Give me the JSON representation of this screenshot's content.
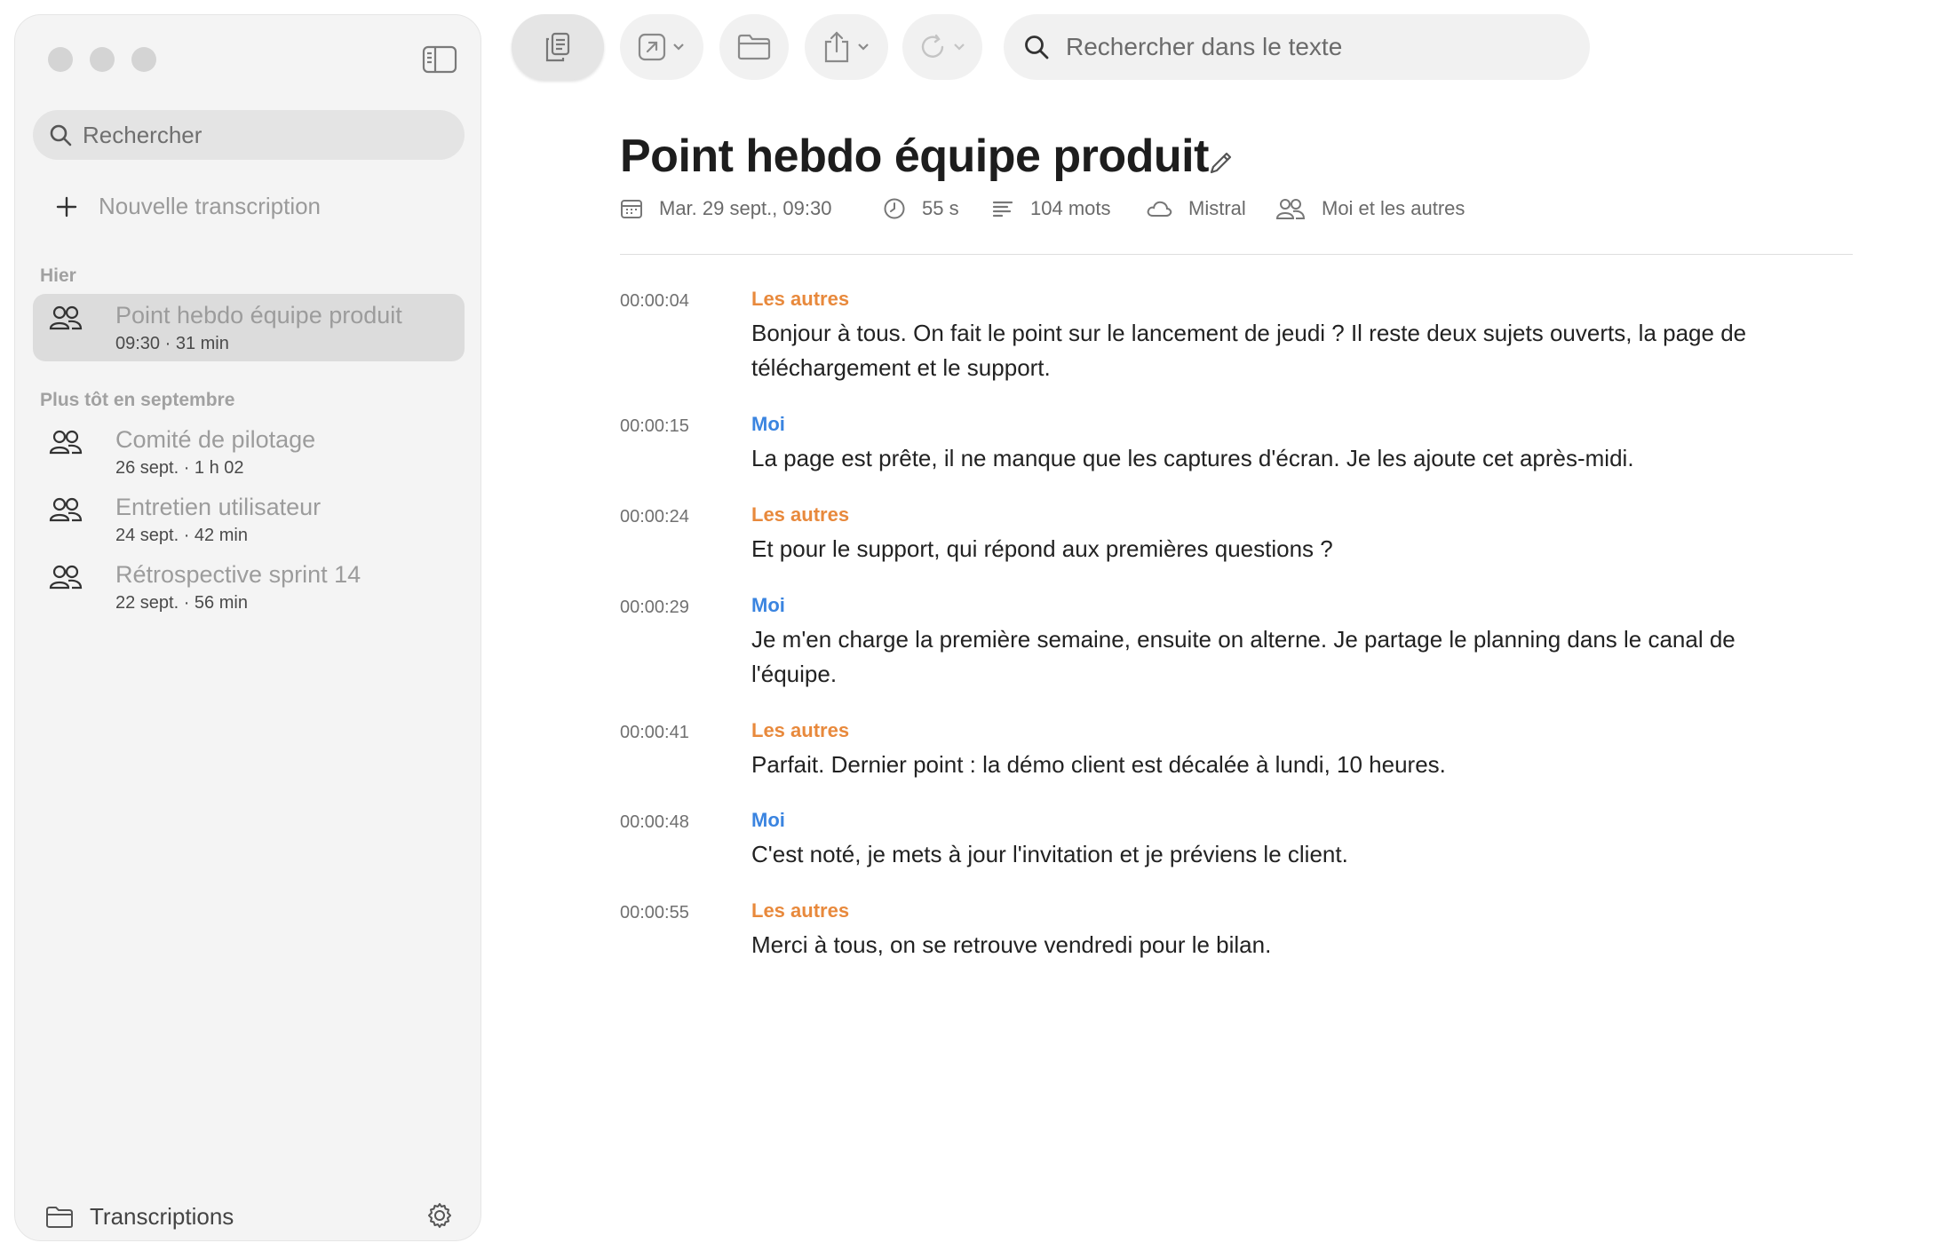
{
  "sidebar": {
    "search_placeholder": "Rechercher",
    "new_transcription": "Nouvelle transcription",
    "sections": [
      {
        "title": "Hier",
        "items": [
          {
            "title": "Point hebdo équipe produit",
            "meta": "09:30 · 31 min",
            "icon": "people-icon",
            "selected": true
          }
        ]
      },
      {
        "title": "Plus tôt en septembre",
        "items": [
          {
            "title": "Comité de pilotage",
            "meta": "26 sept. · 1 h 02",
            "icon": "people-icon"
          },
          {
            "title": "Entretien utilisateur",
            "meta": "24 sept. · 42 min",
            "icon": "people-icon"
          },
          {
            "title": "Rétrospective sprint 14",
            "meta": "22 sept. · 56 min",
            "icon": "people-icon"
          }
        ]
      }
    ],
    "footer_label": "Transcriptions"
  },
  "toolbar": {
    "buttons": [
      "copy-icon",
      "open-external-icon",
      "folder-icon",
      "share-icon",
      "refresh-icon"
    ],
    "search_placeholder": "Rechercher dans le texte"
  },
  "document": {
    "title": "Point hebdo équipe produit",
    "meta": {
      "date": "Mar. 29 sept., 09:30",
      "duration": "55 s",
      "words": "104 mots",
      "engine": "Mistral",
      "participants": "Moi et les autres"
    },
    "entries": [
      {
        "time": "00:00:04",
        "speaker": "Les autres",
        "role": "others",
        "text": "Bonjour à tous. On fait le point sur le lancement de jeudi ? Il reste deux sujets ouverts, la page de téléchargement et le support."
      },
      {
        "time": "00:00:15",
        "speaker": "Moi",
        "role": "me",
        "text": "La page est prête, il ne manque que les captures d'écran. Je les ajoute cet après-midi."
      },
      {
        "time": "00:00:24",
        "speaker": "Les autres",
        "role": "others",
        "text": "Et pour le support, qui répond aux premières questions ?"
      },
      {
        "time": "00:00:29",
        "speaker": "Moi",
        "role": "me",
        "text": "Je m'en charge la première semaine, ensuite on alterne. Je partage le planning dans le canal de l'équipe."
      },
      {
        "time": "00:00:41",
        "speaker": "Les autres",
        "role": "others",
        "text": "Parfait. Dernier point : la démo client est décalée à lundi, 10 heures."
      },
      {
        "time": "00:00:48",
        "speaker": "Moi",
        "role": "me",
        "text": "C'est noté, je mets à jour l'invitation et je préviens le client."
      },
      {
        "time": "00:00:55",
        "speaker": "Les autres",
        "role": "others",
        "text": "Merci à tous, on se retrouve vendredi pour le bilan."
      }
    ]
  },
  "colors": {
    "others": "#e8893c",
    "me": "#3a84e0",
    "sidebar_bg": "#f4f4f4",
    "selected_bg": "#dcdcdc"
  }
}
